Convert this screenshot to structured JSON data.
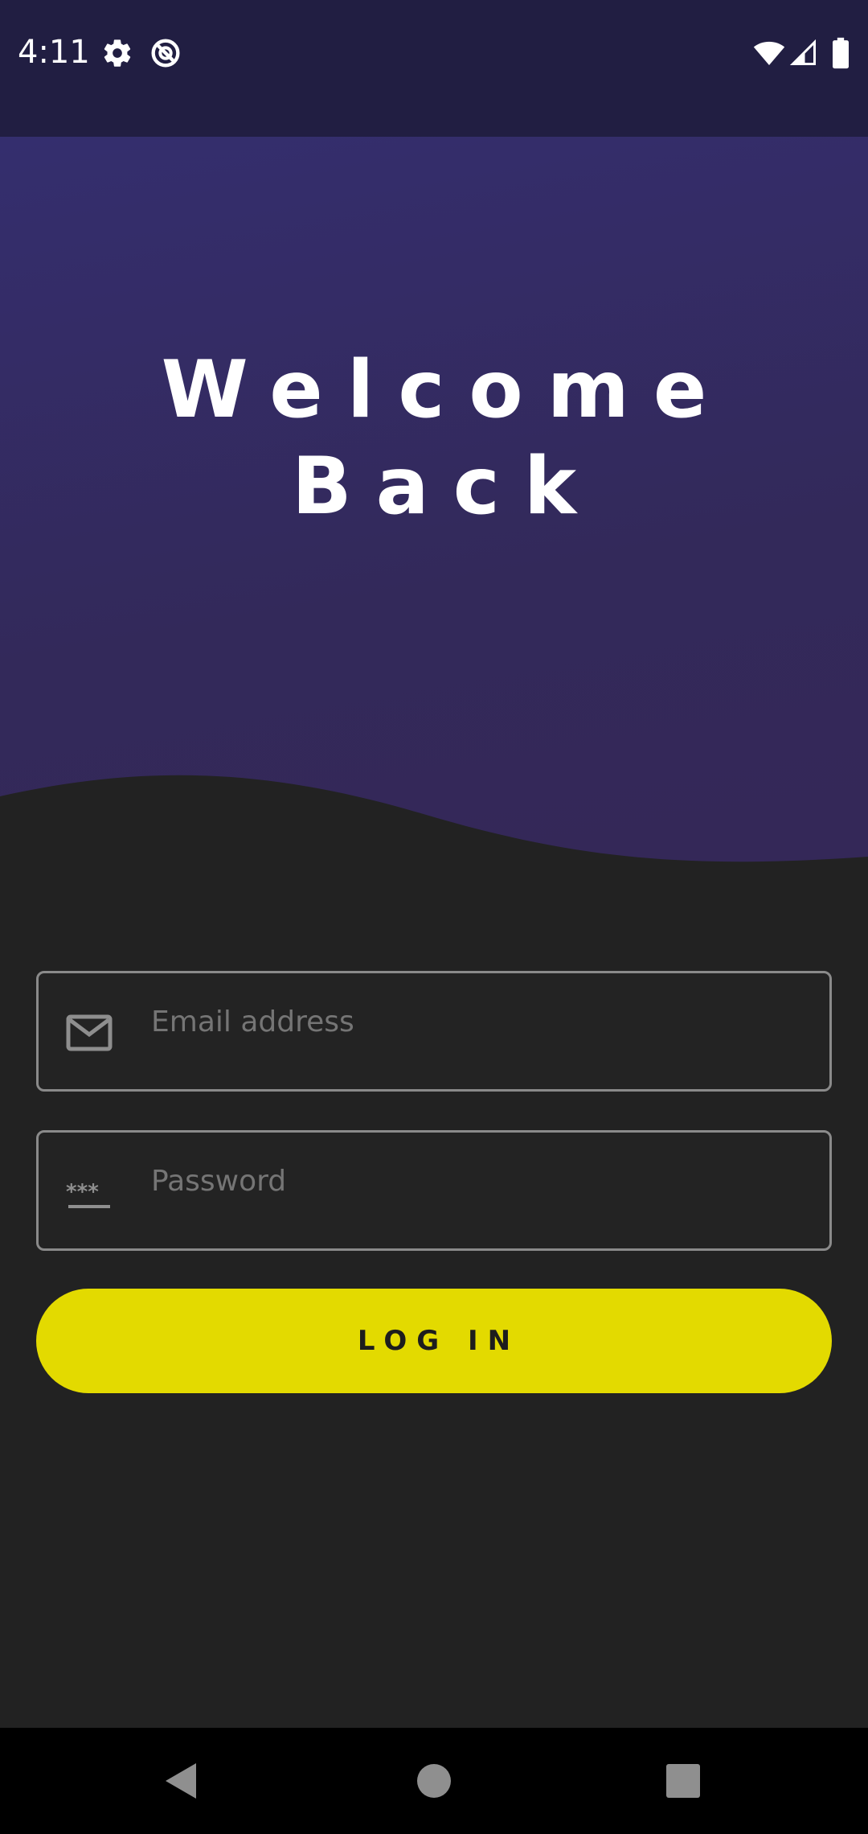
{
  "status_bar": {
    "time": "4:11",
    "icons_left": [
      "settings-icon",
      "data-saver-icon"
    ],
    "icons_right": [
      "wifi-icon",
      "cell-signal-icon",
      "battery-icon"
    ]
  },
  "hero": {
    "title_line1": "Welcome",
    "title_line2": "Back"
  },
  "form": {
    "email_placeholder": "Email address",
    "email_icon": "mail-icon",
    "password_placeholder": "Password",
    "password_icon": "password-icon",
    "login_label": "LOG IN"
  },
  "nav_bar": {
    "buttons": [
      "back-icon",
      "home-icon",
      "recents-icon"
    ]
  },
  "colors": {
    "status_bar": "#211e42",
    "hero": "#342e6e",
    "background": "#222222",
    "accent": "#e3da00"
  }
}
